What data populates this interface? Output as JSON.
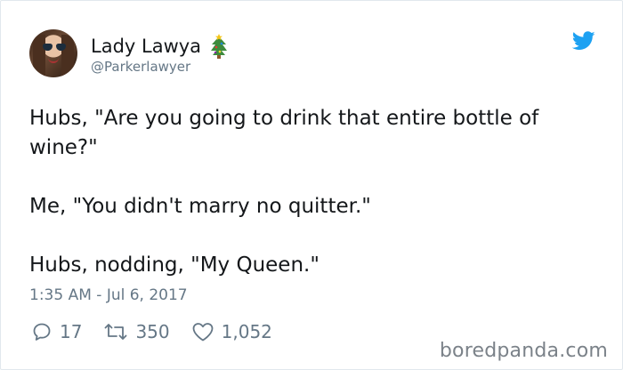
{
  "user": {
    "display_name": "Lady Lawya",
    "handle": "@Parkerlawyer"
  },
  "tweet": {
    "text": "Hubs, \"Are you going to drink that entire bottle of\nwine?\"\n\nMe, \"You didn't marry no quitter.\"\n\nHubs, nodding, \"My Queen.\"",
    "timestamp": "1:35 AM - Jul 6, 2017"
  },
  "actions": {
    "replies": "17",
    "retweets": "350",
    "likes": "1,052"
  },
  "watermark": "boredpanda.com",
  "icons": {
    "emoji": "christmas-tree-icon",
    "brand": "twitter-bird-icon",
    "reply": "reply-icon",
    "retweet": "retweet-icon",
    "like": "heart-icon"
  },
  "colors": {
    "twitter_blue": "#1da1f2",
    "secondary_text": "#657786",
    "primary_text": "#14171a"
  }
}
